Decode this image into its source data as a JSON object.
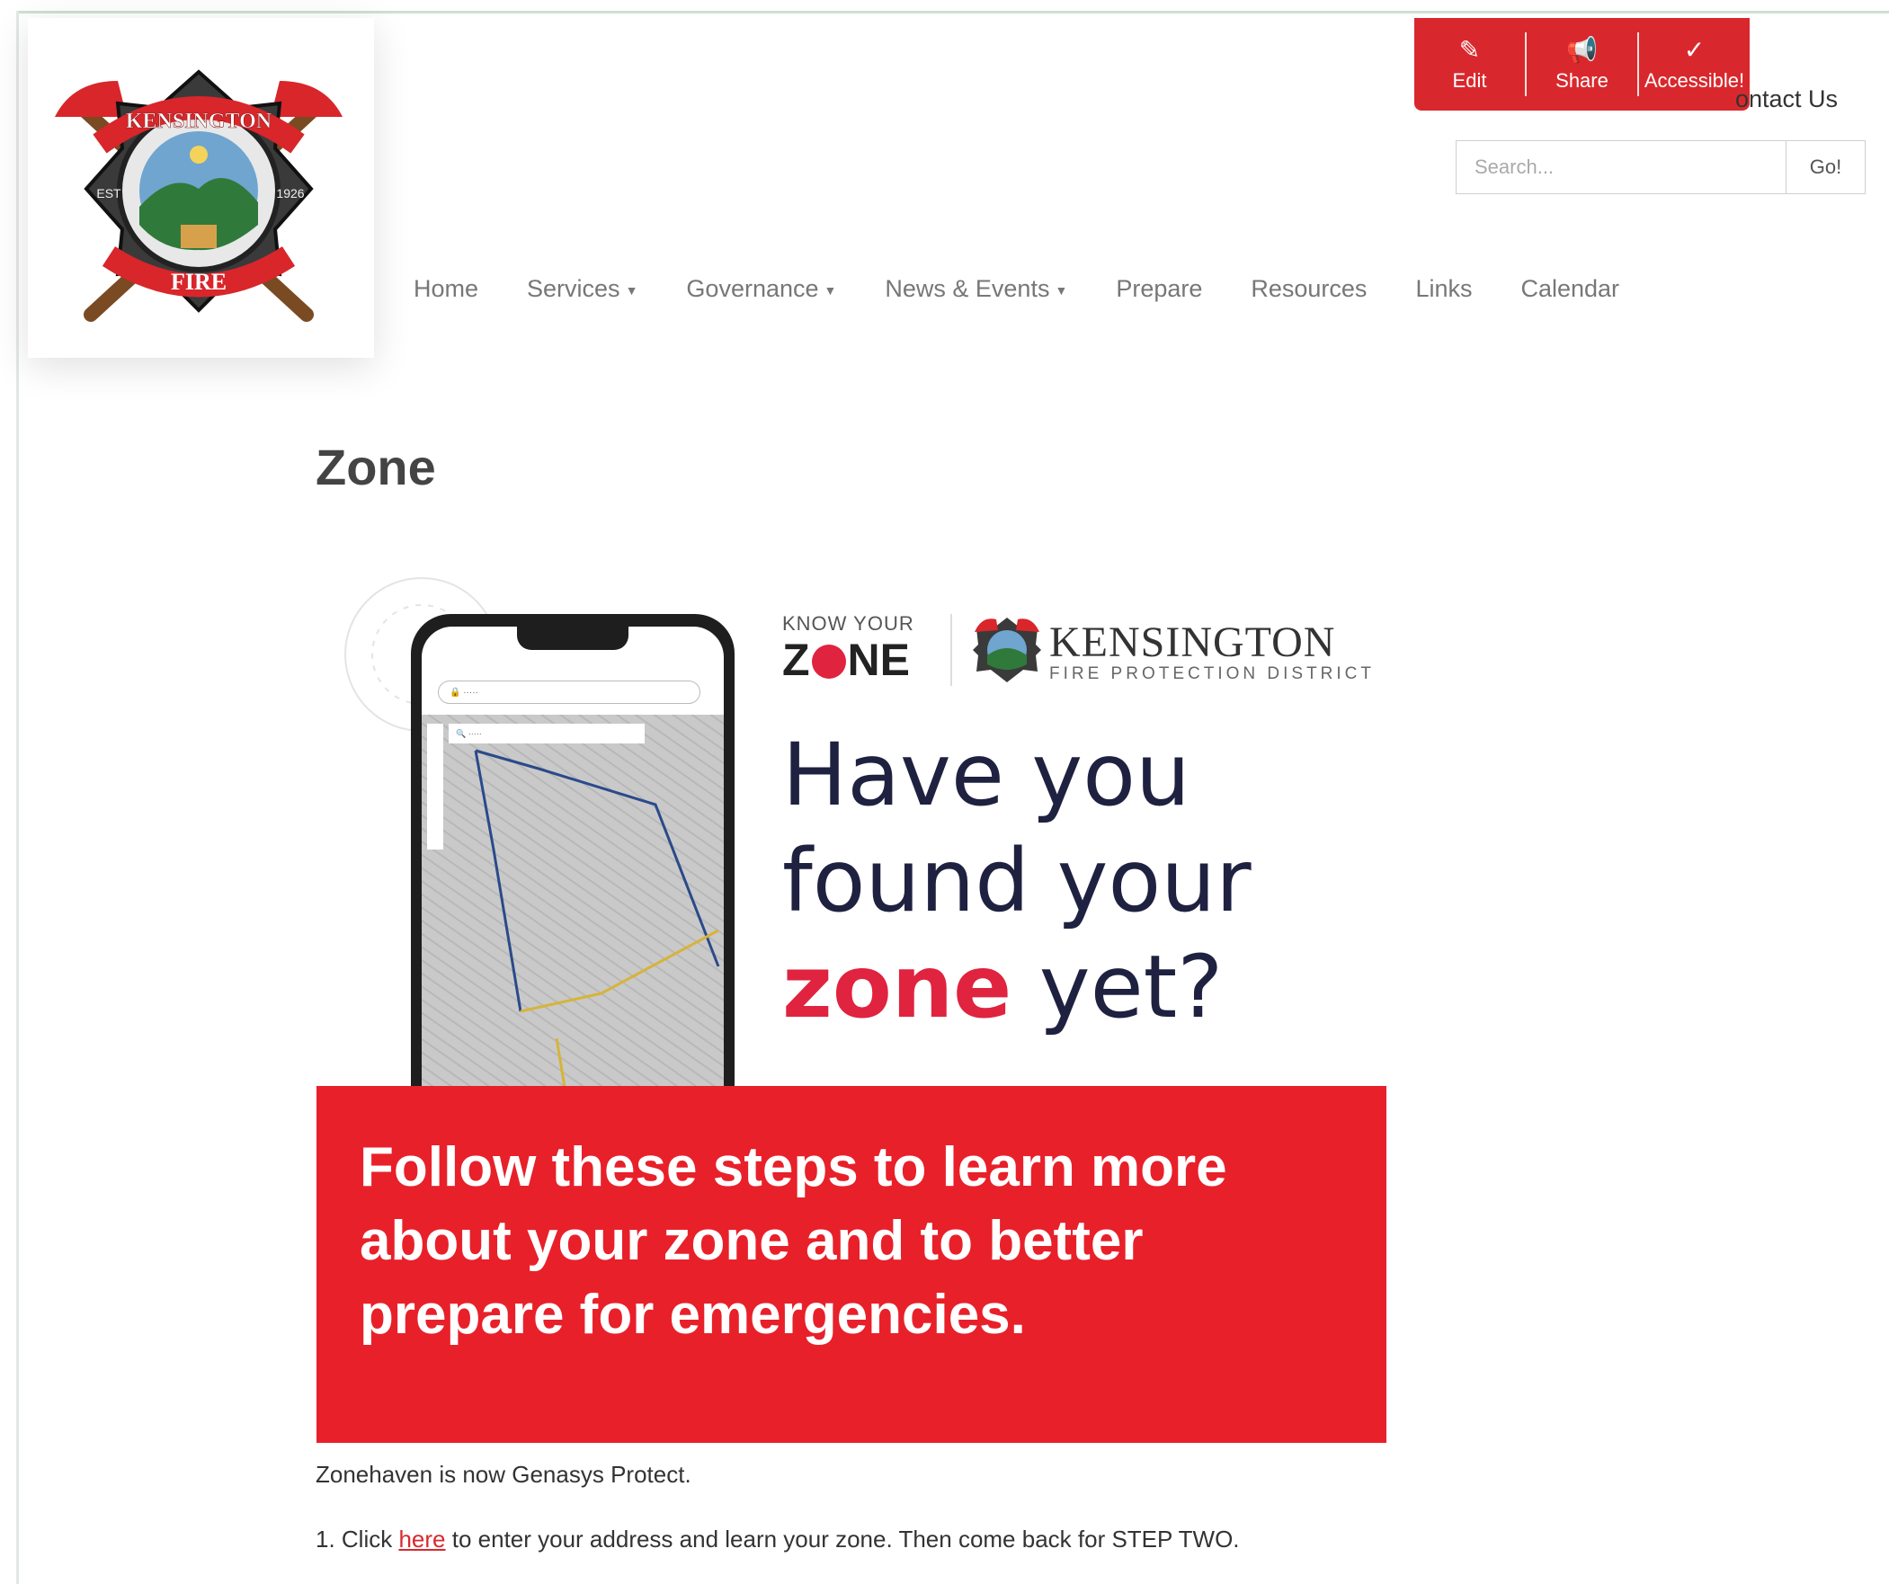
{
  "toolbar": {
    "edit_label": "Edit",
    "share_label": "Share",
    "accessible_label": "Accessible!",
    "color": "#d9282d"
  },
  "header": {
    "contact_link": "ontact Us",
    "search": {
      "placeholder": "Search...",
      "button": "Go!"
    }
  },
  "logo": {
    "top_text": "KENSINGTON",
    "bottom_text": "FIRE",
    "left_text": "EST",
    "right_text": "1926"
  },
  "nav": {
    "items": [
      {
        "label": "Home",
        "dropdown": false
      },
      {
        "label": "Services",
        "dropdown": true
      },
      {
        "label": "Governance",
        "dropdown": true
      },
      {
        "label": "News & Events",
        "dropdown": true
      },
      {
        "label": "Prepare",
        "dropdown": false
      },
      {
        "label": "Resources",
        "dropdown": false
      },
      {
        "label": "Links",
        "dropdown": false
      },
      {
        "label": "Calendar",
        "dropdown": false
      }
    ]
  },
  "page": {
    "title": "Zone"
  },
  "banner": {
    "know_your": "KNOW YOUR",
    "zone_z": "Z",
    "zone_ne": "NE",
    "brand_name": "KENSINGTON",
    "brand_sub": "FIRE PROTECTION DISTRICT",
    "headline_line1": "Have you",
    "headline_line2": "found your",
    "headline_highlight": "zone",
    "headline_end": " yet?",
    "steps_text": "Follow these steps  to learn more about your zone and to better prepare for emergencies.",
    "accent_color": "#e0233f",
    "box_color": "#e8202a"
  },
  "content": {
    "para1": "Zonehaven is now Genasys Protect.",
    "para2_prefix": "1. Click ",
    "para2_link": "here",
    "para2_suffix": " to enter your address and learn your zone. Then come back for STEP TWO."
  }
}
